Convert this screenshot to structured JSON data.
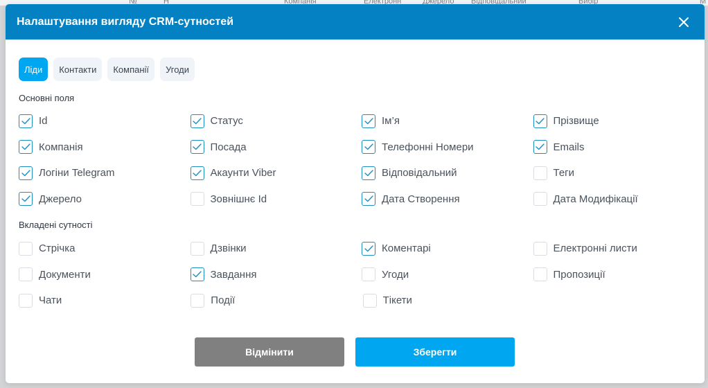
{
  "background": {
    "snippets": [
      "№",
      "Н",
      "Компанія",
      "Електронн",
      "Джерело",
      "Відповідальний",
      "Вибір",
      "М"
    ]
  },
  "modal": {
    "title": "Налаштування вигляду CRM-сутностей",
    "close_icon": "close-icon",
    "tabs": [
      {
        "label": "Ліди",
        "active": true
      },
      {
        "label": "Контакти",
        "active": false
      },
      {
        "label": "Компанії",
        "active": false
      },
      {
        "label": "Угоди",
        "active": false
      }
    ],
    "main_fields": {
      "label": "Основні поля",
      "items": [
        {
          "label": "Id",
          "checked": true
        },
        {
          "label": "Статус",
          "checked": true
        },
        {
          "label": "Ім’я",
          "checked": true
        },
        {
          "label": "Прізвище",
          "checked": true
        },
        {
          "label": "Компанія",
          "checked": true
        },
        {
          "label": "Посада",
          "checked": true
        },
        {
          "label": "Телефонні Номери",
          "checked": true
        },
        {
          "label": "Emails",
          "checked": true
        },
        {
          "label": "Логіни Telegram",
          "checked": true
        },
        {
          "label": "Акаунти Viber",
          "checked": true
        },
        {
          "label": "Відповідальний",
          "checked": true
        },
        {
          "label": "Теги",
          "checked": false
        },
        {
          "label": "Джерело",
          "checked": true
        },
        {
          "label": "Зовнішнє Id",
          "checked": false
        },
        {
          "label": "Дата Створення",
          "checked": true
        },
        {
          "label": "Дата Модифікації",
          "checked": false
        }
      ]
    },
    "nested_entities": {
      "label": "Вкладені сутності",
      "items": [
        {
          "label": "Стрічка",
          "checked": false
        },
        {
          "label": "Дзвінки",
          "checked": false
        },
        {
          "label": "Коментарі",
          "checked": true
        },
        {
          "label": "Електронні листи",
          "checked": false
        },
        {
          "label": "Документи",
          "checked": false
        },
        {
          "label": "Завдання",
          "checked": true
        },
        {
          "label": "Угоди",
          "checked": false
        },
        {
          "label": "Пропозиції",
          "checked": false
        },
        {
          "label": "Чати",
          "checked": false
        },
        {
          "label": "Події",
          "checked": false
        },
        {
          "label": "Тікети",
          "checked": false
        }
      ]
    },
    "buttons": {
      "cancel": "Відмінити",
      "save": "Зберегти"
    }
  },
  "colors": {
    "header": "#0481c2",
    "accent": "#00a6ef",
    "cancel": "#808080",
    "check": "#1b8fbf"
  }
}
